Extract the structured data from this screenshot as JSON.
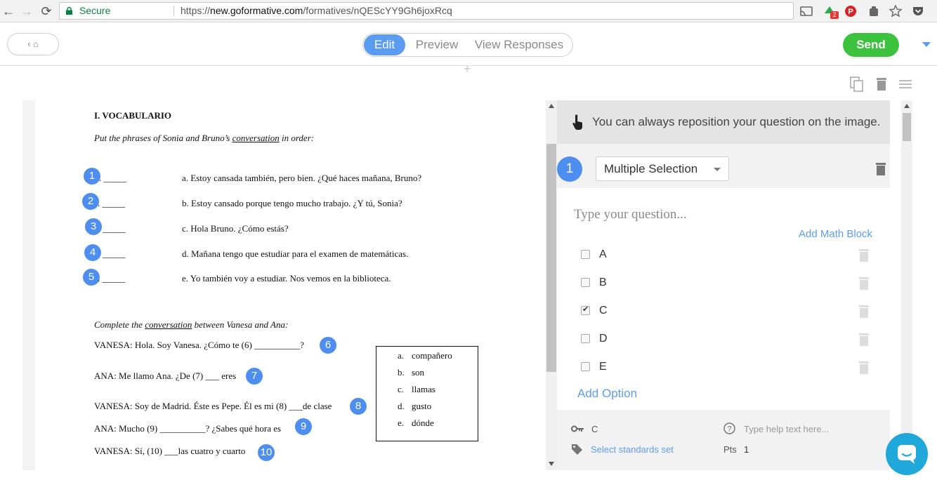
{
  "browser": {
    "back": "←",
    "forward": "→",
    "reload": "⟳",
    "secure_label": "Secure",
    "url_scheme": "https://",
    "url_host": "new.goformative.com",
    "url_path": "/formatives/nQEScYY9Gh6joxRcq",
    "ext_badge": "2"
  },
  "header": {
    "back_label": "‹ ⌂",
    "tabs": [
      {
        "label": "Edit",
        "active": true
      },
      {
        "label": "Preview",
        "active": false
      },
      {
        "label": "View Responses",
        "active": false
      }
    ],
    "send_label": "Send",
    "plus": "+"
  },
  "doc": {
    "heading": "I. VOCABULARIO",
    "instr1_a": "Put the phrases of Sonia and Bruno’s ",
    "instr1_ul": "conversation",
    "instr1_b": " in order:",
    "order_items": [
      {
        "num": "1",
        "blank": ". _____",
        "text": "a. Estoy cansada también, pero bien. ¿Qué haces mañana, Bruno?"
      },
      {
        "num": "2",
        "blank": ". _____",
        "text": "b. Estoy cansado porque tengo mucho trabajo. ¿Y tú, Sonia?"
      },
      {
        "num": "3",
        "blank": "_____",
        "text": "c. Hola Bruno. ¿Cómo estás?"
      },
      {
        "num": "4",
        "blank": "_____",
        "text": "d. Mañana tengo que estudiar para el examen de matemáticas."
      },
      {
        "num": "5",
        "blank": ". _____",
        "text": "e. Yo también voy a estudiar. Nos vemos en la biblioteca."
      }
    ],
    "instr2_a": "Complete the ",
    "instr2_ul": "conversation",
    "instr2_b": " between Vanesa and Ana:",
    "conv_lines": [
      {
        "text": "VANESA: Hola. Soy Vanesa. ¿Cómo te (6) __________?",
        "num": "6"
      },
      {
        "text": "ANA: Me llamo Ana. ¿De (7) ___ eres",
        "num": "7"
      },
      {
        "text": "VANESA: Soy de Madrid. Éste es Pepe. Él es mi (8) ___de clase",
        "num": "8"
      },
      {
        "text": "ANA: Mucho (9) __________? ¿Sabes qué hora es",
        "num": "9"
      },
      {
        "text": "VANESA: Sí, (10) ___las cuatro y cuarto",
        "num": "10"
      }
    ],
    "word_bank": [
      {
        "letter": "a.",
        "word": "compañero"
      },
      {
        "letter": "b.",
        "word": "son"
      },
      {
        "letter": "c.",
        "word": "llamas"
      },
      {
        "letter": "d.",
        "word": "gusto"
      },
      {
        "letter": "e.",
        "word": "dónde"
      }
    ]
  },
  "panel": {
    "hint": "You can always reposition your question on the image.",
    "question_number": "1",
    "question_type": "Multiple Selection",
    "question_placeholder": "Type your question...",
    "add_math_block": "Add Math Block",
    "options": [
      {
        "label": "A",
        "checked": false
      },
      {
        "label": "B",
        "checked": false
      },
      {
        "label": "C",
        "checked": true
      },
      {
        "label": "D",
        "checked": false
      },
      {
        "label": "E",
        "checked": false
      }
    ],
    "add_option": "Add Option",
    "answer_key": "C",
    "help_placeholder": "Type help text here...",
    "standards_link": "Select standards set",
    "pts_label": "Pts",
    "pts_value": "1"
  },
  "colors": {
    "accent": "#5b9cf2",
    "badge": "#4d8ef0",
    "send": "#3dc23d",
    "chat": "#1fa8d9"
  }
}
